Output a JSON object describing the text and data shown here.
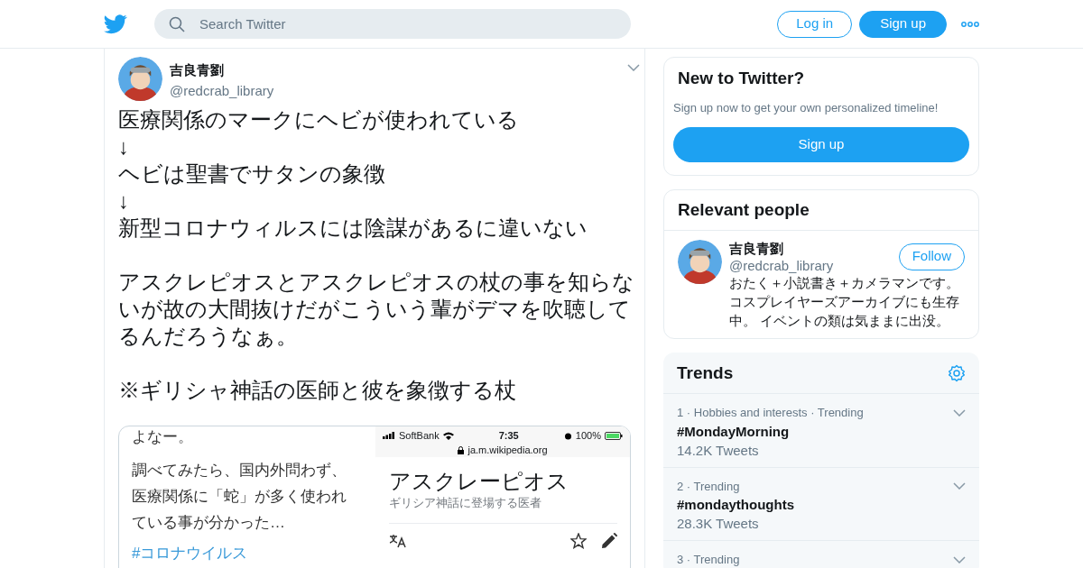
{
  "header": {
    "search": {
      "placeholder": "Search Twitter"
    },
    "login": "Log in",
    "signup": "Sign up"
  },
  "tweet": {
    "name": "吉良青劉",
    "handle": "@redcrab_library",
    "paragraphs": [
      [
        "医療関係のマークにヘビが使われている",
        "↓",
        "ヘビは聖書でサタンの象徴",
        "↓",
        "新型コロナウィルスには陰謀があるに違いない"
      ],
      [
        "アスクレピオスとアスクレピオスの杖の事を知らないが故の大間抜けだがこういう輩がデマを吹聴してるんだろうなぁ。"
      ],
      [
        "※ギリシャ神話の医師と彼を象徴する杖"
      ]
    ],
    "media": {
      "left": {
        "top_line": "よなー。",
        "paragraph": "調べてみたら、国内外問わず、医療関係に「蛇」が多く使われている事が分かった…",
        "hashtag": "#コロナウイルス"
      },
      "phone": {
        "carrier": "SoftBank",
        "time": "7:35",
        "battery": "100%",
        "url": "ja.m.wikipedia.org",
        "title": "アスクレーピオス",
        "subtitle": "ギリシア神話に登場する医者"
      }
    }
  },
  "new_to_twitter": {
    "title": "New to Twitter?",
    "text": "Sign up now to get your own personalized timeline!",
    "button": "Sign up"
  },
  "relevant_people": {
    "title": "Relevant people",
    "people": [
      {
        "name": "吉良青劉",
        "handle": "@redcrab_library",
        "button": "Follow",
        "bio": "おたく＋小説書き＋カメラマンです。コスプレイヤーズアーカイブにも生存中。 イベントの類は気ままに出没。"
      }
    ]
  },
  "trends": {
    "title": "Trends",
    "items": [
      {
        "meta": "1 · Hobbies and interests · Trending",
        "name": "#MondayMorning",
        "count": "14.2K Tweets"
      },
      {
        "meta": "2 · Trending",
        "name": "#mondaythoughts",
        "count": "28.3K Tweets"
      },
      {
        "meta": "3 · Trending"
      }
    ]
  }
}
